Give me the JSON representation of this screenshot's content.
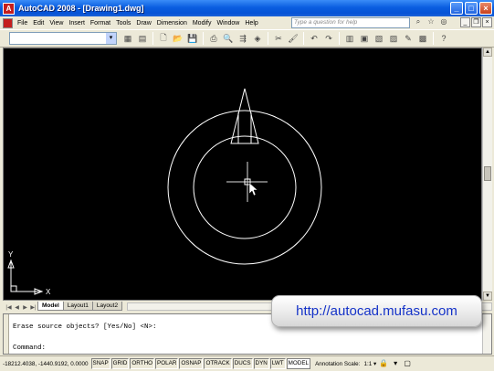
{
  "window": {
    "app_icon_text": "A",
    "title": "AutoCAD 2008 - [Drawing1.dwg]",
    "minimize": "_",
    "maximize": "□",
    "close": "×"
  },
  "menubar": {
    "items": [
      "File",
      "Edit",
      "View",
      "Insert",
      "Format",
      "Tools",
      "Draw",
      "Dimension",
      "Modify",
      "Window",
      "Help"
    ],
    "help_placeholder": "Type a question for help",
    "icons": [
      "binoculars-icon",
      "star-icon",
      "globe-icon"
    ],
    "doc_minimize": "_",
    "doc_restore": "❐",
    "doc_close": "×"
  },
  "toolbar": {
    "workspace_value": "",
    "dropdown_arrow": "▾"
  },
  "drawing": {
    "background": "#000000",
    "line_color": "#ffffff",
    "ucs_x": "X",
    "ucs_y": "Y"
  },
  "tabs": {
    "nav": [
      "|◀",
      "◀",
      "▶",
      "▶|"
    ],
    "items": [
      {
        "label": "Model",
        "active": true
      },
      {
        "label": "Layout1",
        "active": false
      },
      {
        "label": "Layout2",
        "active": false
      }
    ]
  },
  "command": {
    "history": "Erase source objects? [Yes/No] <N>:",
    "prompt": "Command:"
  },
  "statusbar": {
    "coordinates": "-18212.4038, -1440.9192, 0.0000",
    "toggles": [
      "SNAP",
      "GRID",
      "ORTHO",
      "POLAR",
      "OSNAP",
      "OTRACK",
      "DUCS",
      "DYN",
      "LWT",
      "MODEL"
    ],
    "annotation_scale_label": "Annotation Scale:",
    "annotation_scale_value": "1:1 ▾"
  },
  "watermark": {
    "text": "http://autocad.mufasu.com",
    "color": "#1432c8"
  }
}
